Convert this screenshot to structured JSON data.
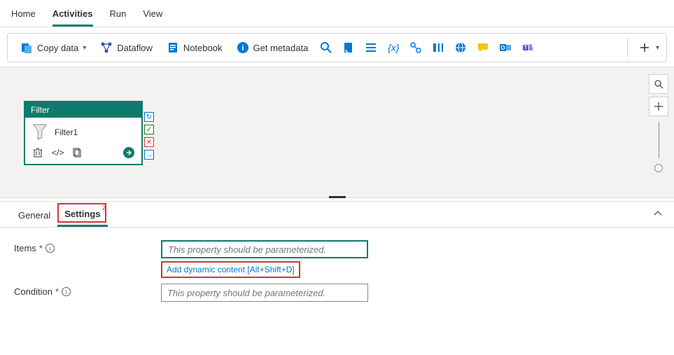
{
  "topTabs": {
    "home": "Home",
    "activities": "Activities",
    "run": "Run",
    "view": "View"
  },
  "toolbar": {
    "copyData": "Copy data",
    "dataflow": "Dataflow",
    "notebook": "Notebook",
    "getMetadata": "Get metadata"
  },
  "node": {
    "type": "Filter",
    "name": "Filter1"
  },
  "lowerTabs": {
    "general": "General",
    "settings": "Settings",
    "badge": "2"
  },
  "form": {
    "itemsLabel": "Items",
    "conditionLabel": "Condition",
    "placeholder": "This property should be parameterized.",
    "dynamicLink": "Add dynamic content [Alt+Shift+D]"
  },
  "colors": {
    "accent": "#0f7b6c",
    "blue": "#0078d4",
    "red": "#d13438"
  }
}
